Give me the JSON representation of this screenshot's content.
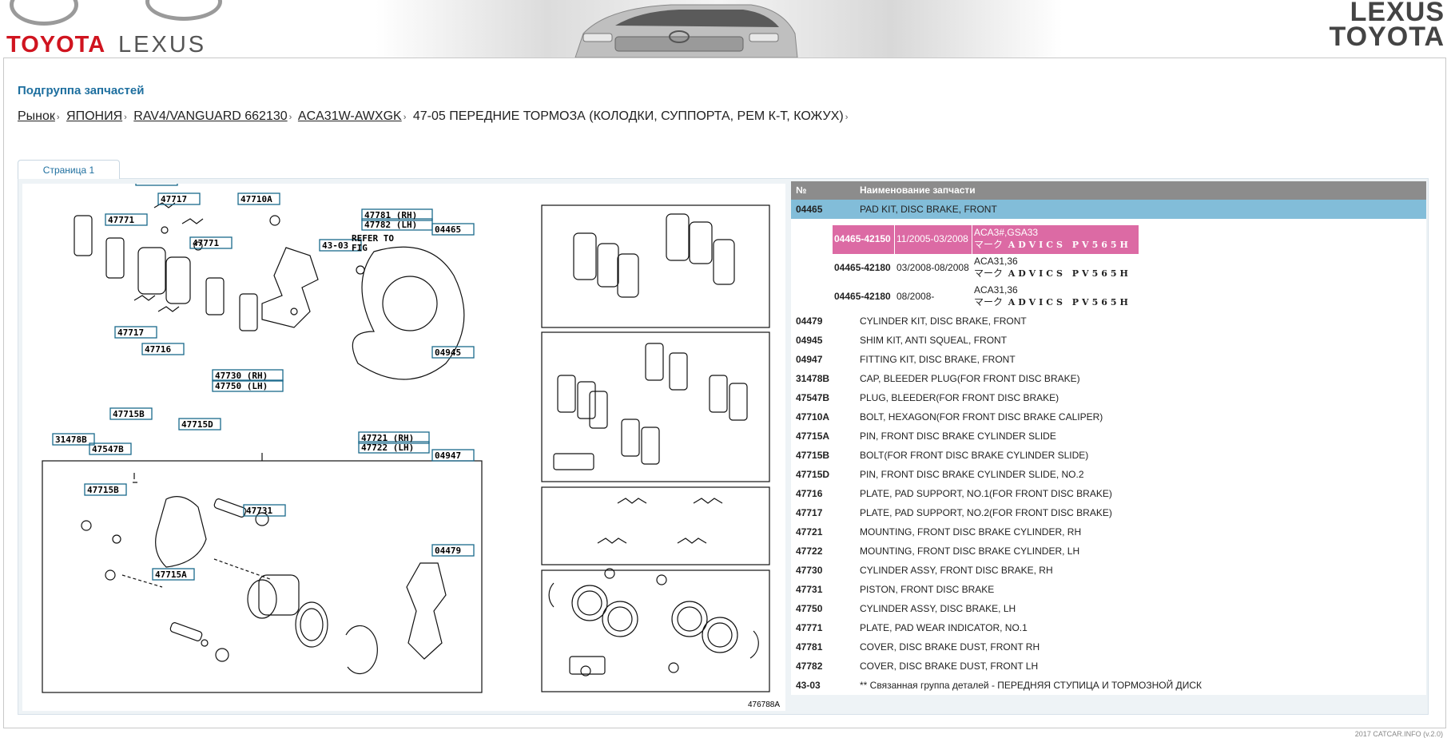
{
  "header": {
    "left_logo_1": "TOYOTA",
    "left_logo_2": "LEXUS",
    "right_logo_1": "LEXUS",
    "right_logo_2": "TOYOTA"
  },
  "page": {
    "subgroup_title": "Подгруппа запчастей",
    "breadcrumb": [
      {
        "label": "Рынок",
        "link": true
      },
      {
        "label": "ЯПОНИЯ",
        "link": true
      },
      {
        "label": "RAV4/VANGUARD 662130",
        "link": true
      },
      {
        "label": "ACA31W-AWXGK",
        "link": true
      },
      {
        "label": "47-05 ПЕРЕДНИЕ ТОРМОЗА (КОЛОДКИ, СУППОРТА, РЕМ К-Т, КОЖУХ)",
        "link": false
      }
    ],
    "breadcrumb_sep": "›",
    "tab_label": "Страница 1",
    "footer": "2017 CATCAR.INFO (v.2.0)"
  },
  "diagram": {
    "figure_id": "476788A",
    "refer_text_1": "REFER TO",
    "refer_text_2": "FIG",
    "callouts": [
      "47716",
      "47717",
      "47771",
      "47710A",
      "47781 (RH)",
      "47782 (LH)",
      "43-03",
      "04465",
      "47771",
      "47717",
      "47716",
      "04945",
      "47730 (RH)",
      "47750 (LH)",
      "47715B",
      "47715D",
      "47721 (RH)",
      "47722 (LH)",
      "31478B",
      "47547B",
      "04947",
      "47715B",
      "47731",
      "04479",
      "47715A"
    ]
  },
  "parts_table": {
    "col_no": "№",
    "col_name": "Наименование запчасти",
    "rows": [
      {
        "code": "04465",
        "name": "PAD KIT, DISC BRAKE, FRONT",
        "selected": true
      },
      {
        "code": "04479",
        "name": "CYLINDER KIT, DISC BRAKE, FRONT"
      },
      {
        "code": "04945",
        "name": "SHIM KIT, ANTI SQUEAL, FRONT"
      },
      {
        "code": "04947",
        "name": "FITTING KIT, DISC BRAKE, FRONT"
      },
      {
        "code": "31478B",
        "name": "CAP, BLEEDER PLUG(FOR FRONT DISC BRAKE)"
      },
      {
        "code": "47547B",
        "name": "PLUG, BLEEDER(FOR FRONT DISC BRAKE)"
      },
      {
        "code": "47710A",
        "name": "BOLT, HEXAGON(FOR FRONT DISC BRAKE CALIPER)"
      },
      {
        "code": "47715A",
        "name": "PIN, FRONT DISC BRAKE CYLINDER SLIDE"
      },
      {
        "code": "47715B",
        "name": "BOLT(FOR FRONT DISC BRAKE CYLINDER SLIDE)"
      },
      {
        "code": "47715D",
        "name": "PIN, FRONT DISC BRAKE CYLINDER SLIDE, NO.2"
      },
      {
        "code": "47716",
        "name": "PLATE, PAD SUPPORT, NO.1(FOR FRONT DISC BRAKE)"
      },
      {
        "code": "47717",
        "name": "PLATE, PAD SUPPORT, NO.2(FOR FRONT DISC BRAKE)"
      },
      {
        "code": "47721",
        "name": "MOUNTING, FRONT DISC BRAKE CYLINDER, RH"
      },
      {
        "code": "47722",
        "name": "MOUNTING, FRONT DISC BRAKE CYLINDER, LH"
      },
      {
        "code": "47730",
        "name": "CYLINDER ASSY, FRONT DISC BRAKE, RH"
      },
      {
        "code": "47731",
        "name": "PISTON, FRONT DISC BRAKE"
      },
      {
        "code": "47750",
        "name": "CYLINDER ASSY, DISC BRAKE, LH"
      },
      {
        "code": "47771",
        "name": "PLATE, PAD WEAR INDICATOR, NO.1"
      },
      {
        "code": "47781",
        "name": "COVER, DISC BRAKE DUST, FRONT RH"
      },
      {
        "code": "47782",
        "name": "COVER, DISC BRAKE DUST, FRONT LH"
      },
      {
        "code": "43-03",
        "name": "** Связанная группа деталей - ПЕРЕДНЯЯ СТУПИЦА И ТОРМОЗНОЙ ДИСК"
      }
    ],
    "sub_items": [
      {
        "part_no": "04465-42150",
        "dates": "11/2005-03/2008",
        "models": "ACA3#,GSA33",
        "mark_prefix": "マーク",
        "mark": "ADVICS PV565H",
        "highlight": true
      },
      {
        "part_no": "04465-42180",
        "dates": "03/2008-08/2008",
        "models": "ACA31,36",
        "mark_prefix": "マーク",
        "mark": "ADVICS PV565H",
        "highlight": false
      },
      {
        "part_no": "04465-42180",
        "dates": "08/2008-",
        "models": "ACA31,36",
        "mark_prefix": "マーク",
        "mark": "ADVICS PV565H",
        "highlight": false
      }
    ]
  },
  "colors": {
    "title_blue": "#1e6f9f",
    "selected_row": "#82bdd9",
    "highlight_pink": "#dc6aa4",
    "header_grey": "#8c8c8c",
    "callout_box": "#1a6a8c",
    "toyota_red": "#d0141f"
  }
}
